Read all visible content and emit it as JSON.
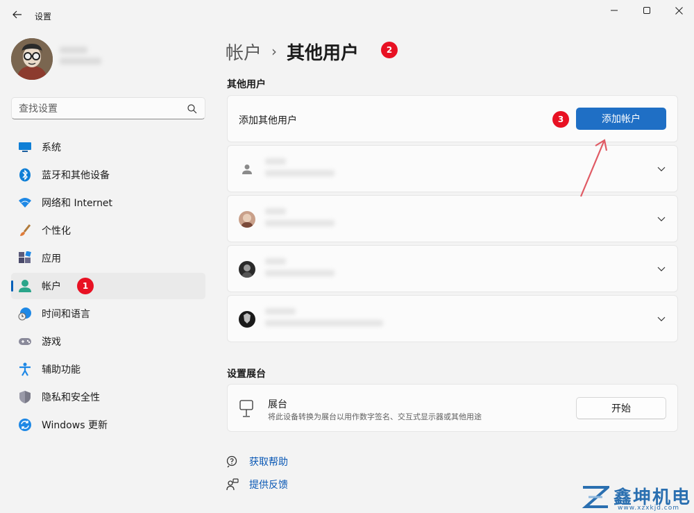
{
  "window": {
    "title": "设置"
  },
  "sidebar": {
    "search_placeholder": "查找设置",
    "items": [
      {
        "label": "系统"
      },
      {
        "label": "蓝牙和其他设备"
      },
      {
        "label": "网络和 Internet"
      },
      {
        "label": "个性化"
      },
      {
        "label": "应用"
      },
      {
        "label": "帐户"
      },
      {
        "label": "时间和语言"
      },
      {
        "label": "游戏"
      },
      {
        "label": "辅助功能"
      },
      {
        "label": "隐私和安全性"
      },
      {
        "label": "Windows 更新"
      }
    ],
    "active_index": 5
  },
  "header": {
    "parent": "帐户",
    "separator": "›",
    "current": "其他用户"
  },
  "other_users": {
    "section_title": "其他用户",
    "add_label": "添加其他用户",
    "add_button": "添加帐户",
    "user_count": 4
  },
  "kiosk": {
    "section_title": "设置展台",
    "title": "展台",
    "description": "将此设备转换为展台以用作数字签名、交互式显示器或其他用途",
    "button": "开始"
  },
  "links": {
    "help": "获取帮助",
    "feedback": "提供反馈"
  },
  "badges": {
    "b1": "1",
    "b2": "2",
    "b3": "3",
    "color": "#e81123"
  },
  "accent_color": "#1f6fc5",
  "watermark": {
    "name": "鑫坤机电",
    "url": "www.xzxkjd.com"
  }
}
